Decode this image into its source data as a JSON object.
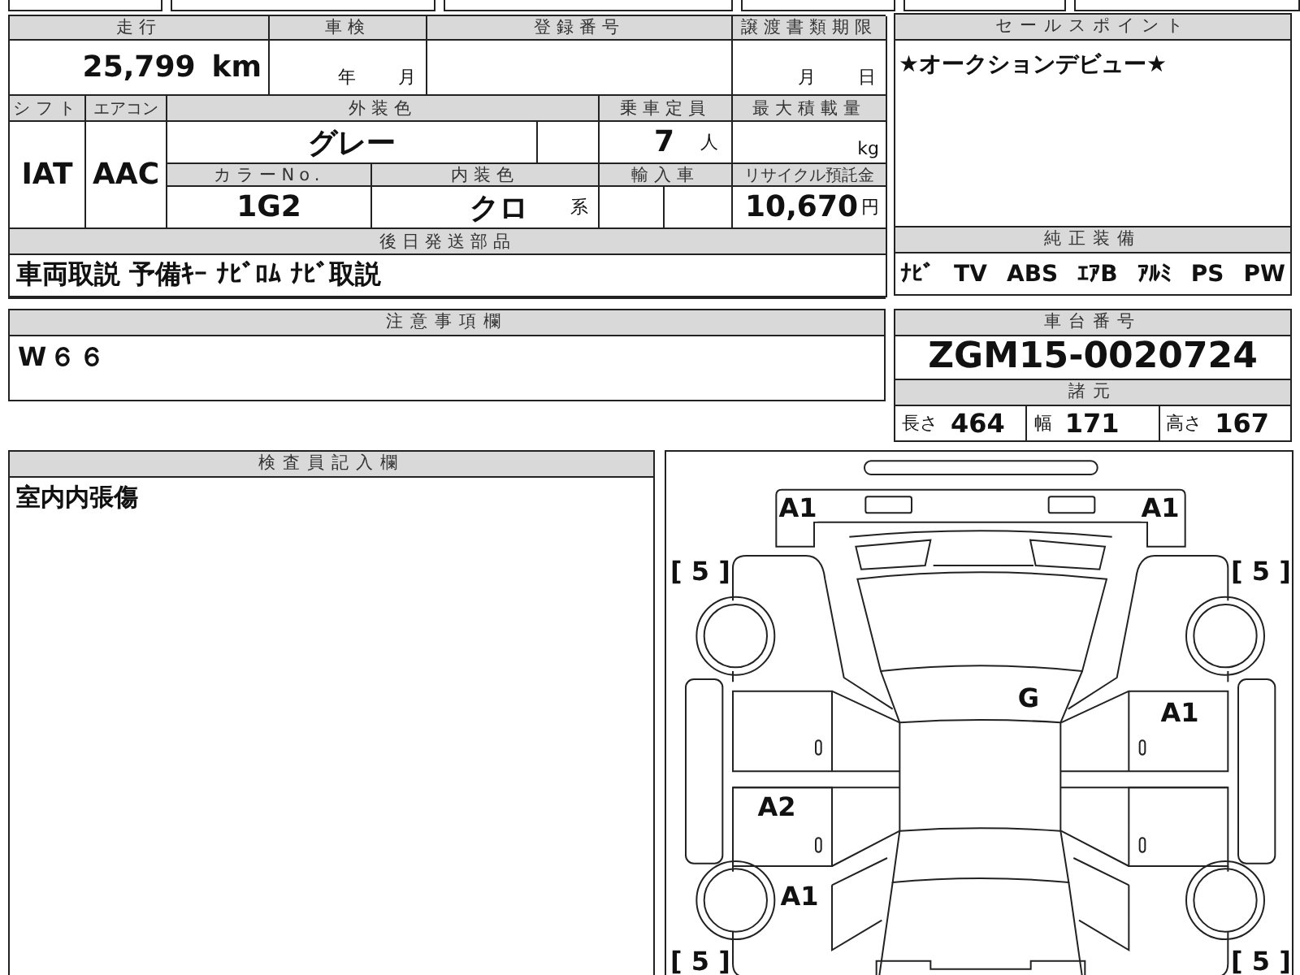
{
  "vehicle_info": {
    "mileage_label": "走行",
    "mileage_value": "25,799",
    "mileage_unit": "km",
    "inspection_label": "車検",
    "inspection_year_unit": "年",
    "inspection_month_unit": "月",
    "registration_label": "登録番号",
    "transfer_deadline_label": "譲渡書類期限",
    "transfer_month_unit": "月",
    "transfer_day_unit": "日",
    "shift_label": "シフト",
    "shift_value": "IAT",
    "ac_label": "エアコン",
    "ac_value": "AAC",
    "exterior_color_label": "外装色",
    "exterior_color_value": "グレー",
    "capacity_label": "乗車定員",
    "capacity_value": "7",
    "capacity_unit": "人",
    "max_load_label": "最大積載量",
    "max_load_unit": "kg",
    "color_no_label": "カラーNo.",
    "color_no_value": "1G2",
    "interior_color_label": "内装色",
    "interior_color_value": "クロ",
    "interior_color_suffix": "系",
    "import_label": "輸入車",
    "recycle_label": "リサイクル預託金",
    "recycle_value": "10,670",
    "recycle_unit": "円"
  },
  "later_parts": {
    "label": "後日発送部品",
    "value": "車両取説 予備ｷｰ ﾅﾋﾞﾛﾑ ﾅﾋﾞ取説"
  },
  "sales_point": {
    "label": "セールスポイント",
    "text": "★オークションデビュー★"
  },
  "standard_equipment": {
    "label": "純正装備",
    "items": [
      "ﾅﾋﾞ",
      "TV",
      "ABS",
      "ｴｱB",
      "ｱﾙﾐ",
      "PS",
      "PW"
    ]
  },
  "notes": {
    "label": "注意事項欄",
    "text": "W６６"
  },
  "chassis": {
    "label": "車台番号",
    "value": "ZGM15-0020724"
  },
  "specs": {
    "label": "諸元",
    "items": [
      {
        "label": "長さ",
        "value": "464"
      },
      {
        "label": "幅",
        "value": "171"
      },
      {
        "label": "高さ",
        "value": "167"
      }
    ]
  },
  "inspector_notes": {
    "label": "検査員記入欄",
    "text": "室内内張傷"
  },
  "damage_map": {
    "marks": {
      "front_left": "A1",
      "front_right": "A1",
      "windshield": "G",
      "right_front_door": "A1",
      "left_rear_door": "A2",
      "left_rear_fender": "A1"
    },
    "tire_ratings": {
      "front_left": "[ 5 ]",
      "front_right": "[ 5 ]",
      "rear_left": "[ 5 ]",
      "rear_right": "[ 5 ]"
    }
  }
}
